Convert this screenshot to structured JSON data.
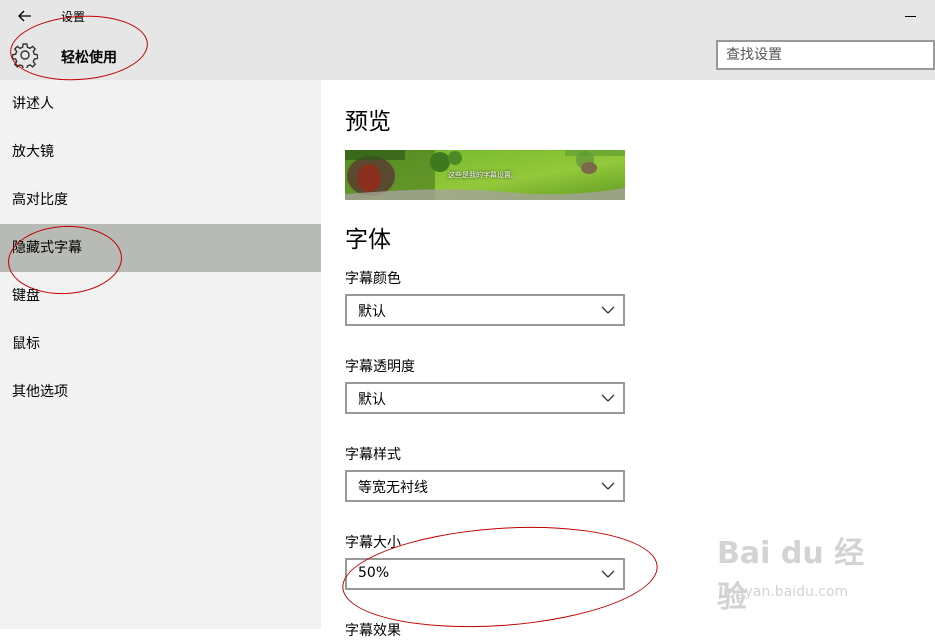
{
  "window": {
    "title": "设置"
  },
  "header": {
    "section_title": "轻松使用",
    "search_placeholder": "查找设置"
  },
  "sidebar": {
    "items": [
      {
        "label": "讲述人",
        "selected": false
      },
      {
        "label": "放大镜",
        "selected": false
      },
      {
        "label": "高对比度",
        "selected": false
      },
      {
        "label": "隐藏式字幕",
        "selected": true
      },
      {
        "label": "键盘",
        "selected": false
      },
      {
        "label": "鼠标",
        "selected": false
      },
      {
        "label": "其他选项",
        "selected": false
      }
    ]
  },
  "main": {
    "preview_heading": "预览",
    "preview_caption": "这些是我的字幕设置。",
    "font_heading": "字体",
    "fields": [
      {
        "label": "字幕颜色",
        "value": "默认"
      },
      {
        "label": "字幕透明度",
        "value": "默认"
      },
      {
        "label": "字幕样式",
        "value": "等宽无衬线"
      },
      {
        "label": "字幕大小",
        "value": "50%"
      }
    ],
    "next_label": "字幕效果"
  },
  "watermark": {
    "brand": "Bai du 经验",
    "url": "jingyan.baidu.com"
  },
  "colors": {
    "sidebar_selected": "#b7bab5",
    "annotation": "#c00000"
  }
}
